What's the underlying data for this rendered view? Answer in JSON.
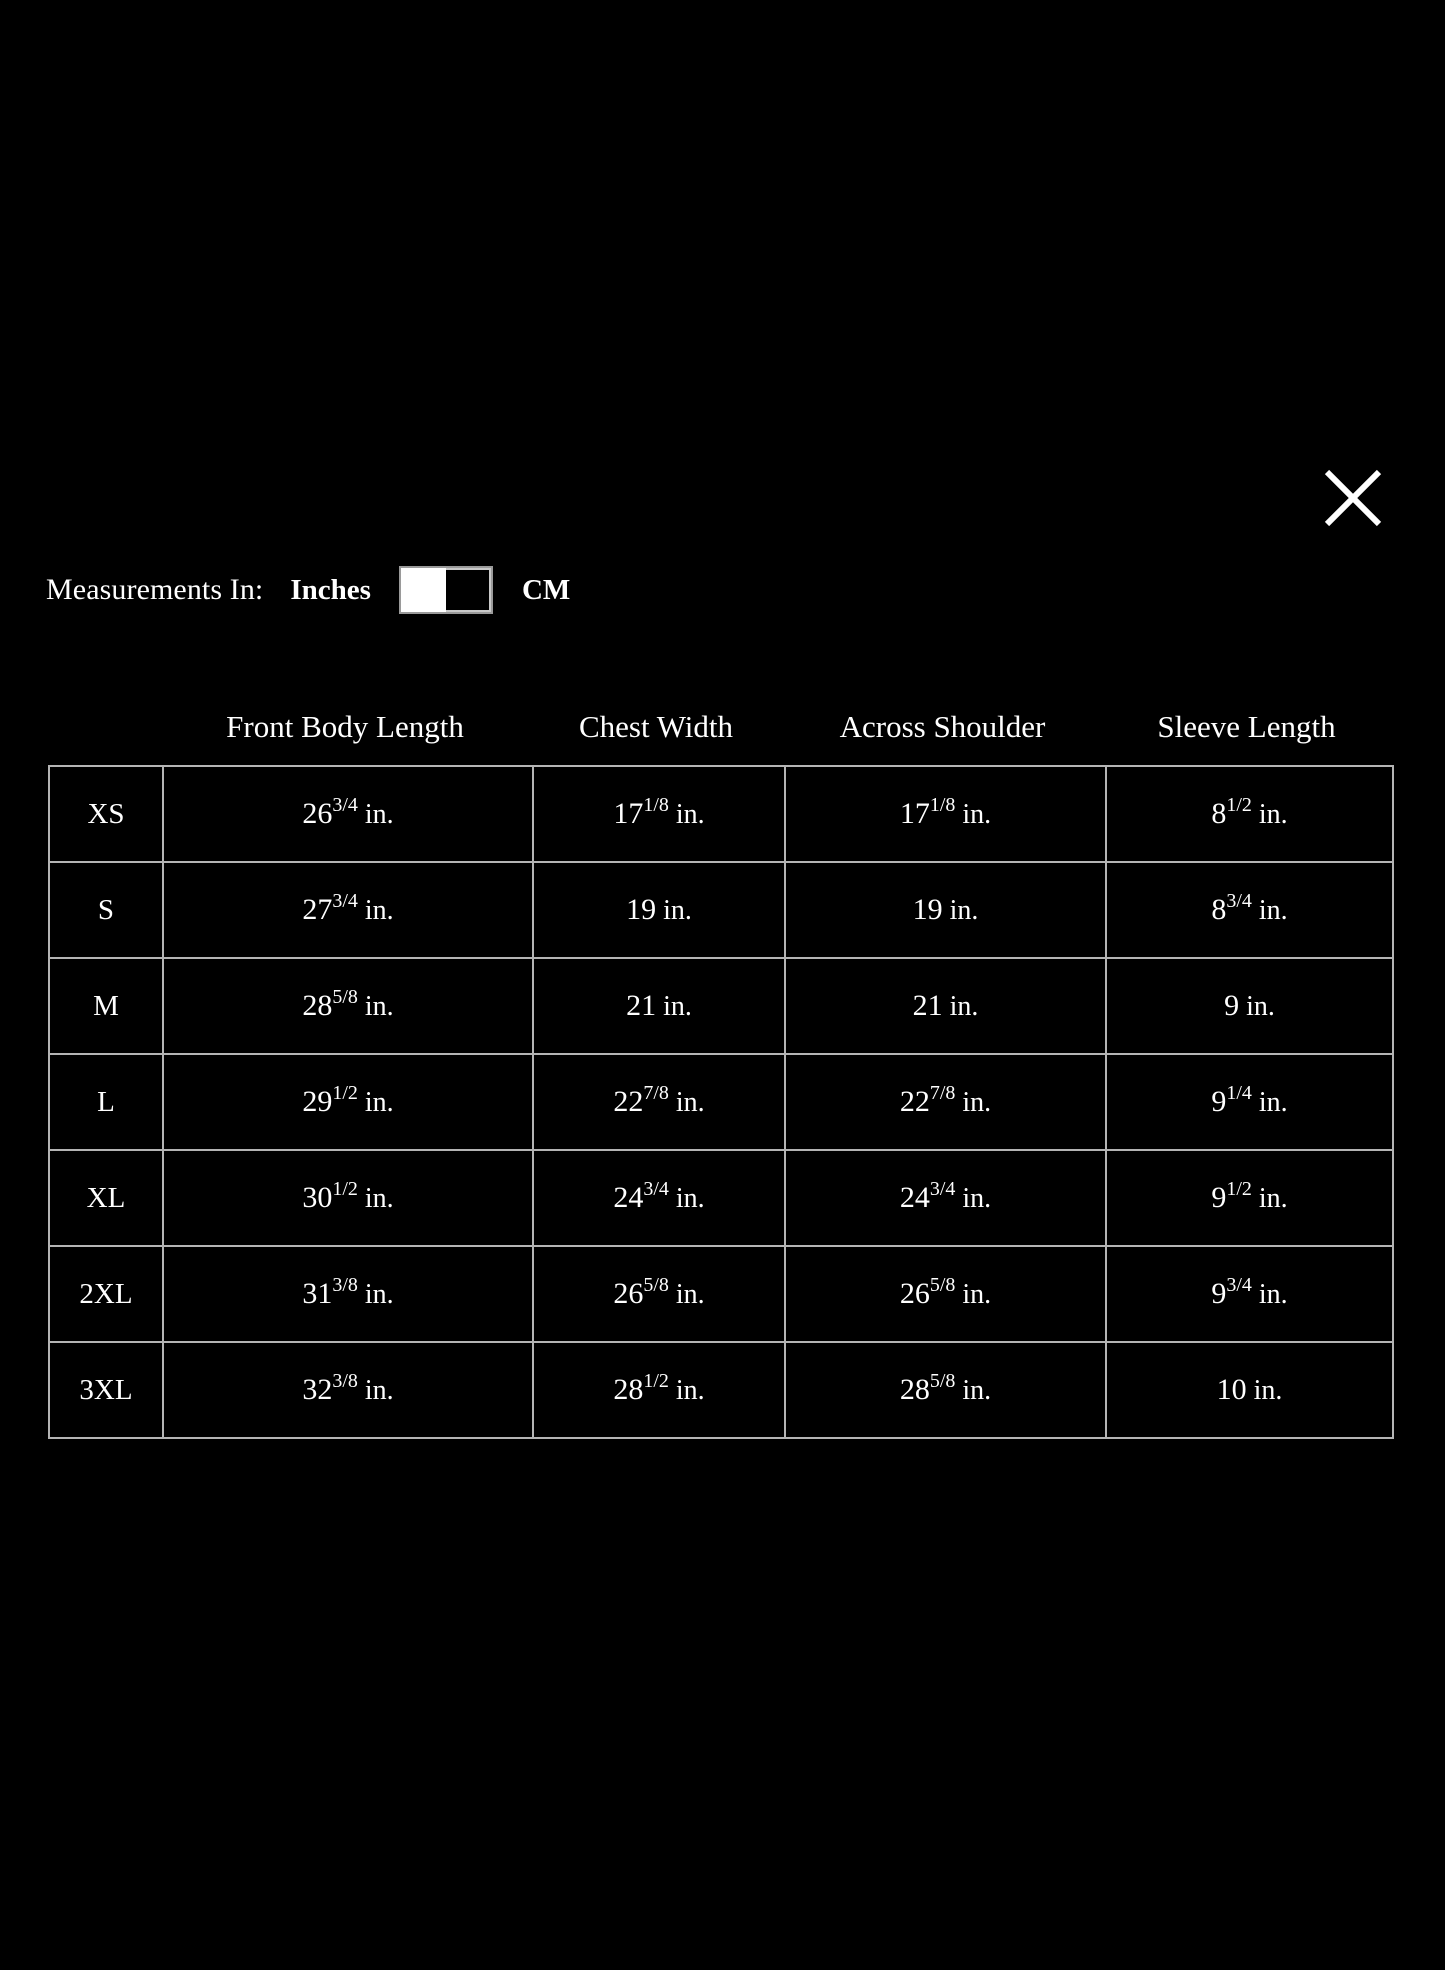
{
  "dialog": {
    "close_icon": "close-x-icon"
  },
  "units": {
    "prompt": "Measurements In:",
    "inches_label": "Inches",
    "cm_label": "CM",
    "selected": "Inches",
    "toggle_icon": "unit-toggle-switch"
  },
  "table": {
    "size_column_header": "",
    "headers": [
      "Front Body Length",
      "Chest Width",
      "Across Shoulder",
      "Sleeve Length"
    ],
    "unit_suffix": "in.",
    "rows": [
      {
        "size": "XS",
        "cells": [
          {
            "whole": "26",
            "frac": "3/4",
            "unit": "in."
          },
          {
            "whole": "17",
            "frac": "1/8",
            "unit": "in."
          },
          {
            "whole": "17",
            "frac": "1/8",
            "unit": "in."
          },
          {
            "whole": "8",
            "frac": "1/2",
            "unit": "in."
          }
        ]
      },
      {
        "size": "S",
        "cells": [
          {
            "whole": "27",
            "frac": "3/4",
            "unit": "in."
          },
          {
            "whole": "19",
            "frac": "",
            "unit": "in."
          },
          {
            "whole": "19",
            "frac": "",
            "unit": "in."
          },
          {
            "whole": "8",
            "frac": "3/4",
            "unit": "in."
          }
        ]
      },
      {
        "size": "M",
        "cells": [
          {
            "whole": "28",
            "frac": "5/8",
            "unit": "in."
          },
          {
            "whole": "21",
            "frac": "",
            "unit": "in."
          },
          {
            "whole": "21",
            "frac": "",
            "unit": "in."
          },
          {
            "whole": "9",
            "frac": "",
            "unit": "in."
          }
        ]
      },
      {
        "size": "L",
        "cells": [
          {
            "whole": "29",
            "frac": "1/2",
            "unit": "in."
          },
          {
            "whole": "22",
            "frac": "7/8",
            "unit": "in."
          },
          {
            "whole": "22",
            "frac": "7/8",
            "unit": "in."
          },
          {
            "whole": "9",
            "frac": "1/4",
            "unit": "in."
          }
        ]
      },
      {
        "size": "XL",
        "cells": [
          {
            "whole": "30",
            "frac": "1/2",
            "unit": "in."
          },
          {
            "whole": "24",
            "frac": "3/4",
            "unit": "in."
          },
          {
            "whole": "24",
            "frac": "3/4",
            "unit": "in."
          },
          {
            "whole": "9",
            "frac": "1/2",
            "unit": "in."
          }
        ]
      },
      {
        "size": "2XL",
        "cells": [
          {
            "whole": "31",
            "frac": "3/8",
            "unit": "in."
          },
          {
            "whole": "26",
            "frac": "5/8",
            "unit": "in."
          },
          {
            "whole": "26",
            "frac": "5/8",
            "unit": "in."
          },
          {
            "whole": "9",
            "frac": "3/4",
            "unit": "in."
          }
        ]
      },
      {
        "size": "3XL",
        "cells": [
          {
            "whole": "32",
            "frac": "3/8",
            "unit": "in."
          },
          {
            "whole": "28",
            "frac": "1/2",
            "unit": "in."
          },
          {
            "whole": "28",
            "frac": "5/8",
            "unit": "in."
          },
          {
            "whole": "10",
            "frac": "",
            "unit": "in."
          }
        ]
      }
    ]
  },
  "colors": {
    "background": "#000000",
    "text": "#ffffff",
    "border": "#b4b4b4",
    "toggle_border": "#9a9a9a",
    "toggle_knob": "#ffffff"
  }
}
